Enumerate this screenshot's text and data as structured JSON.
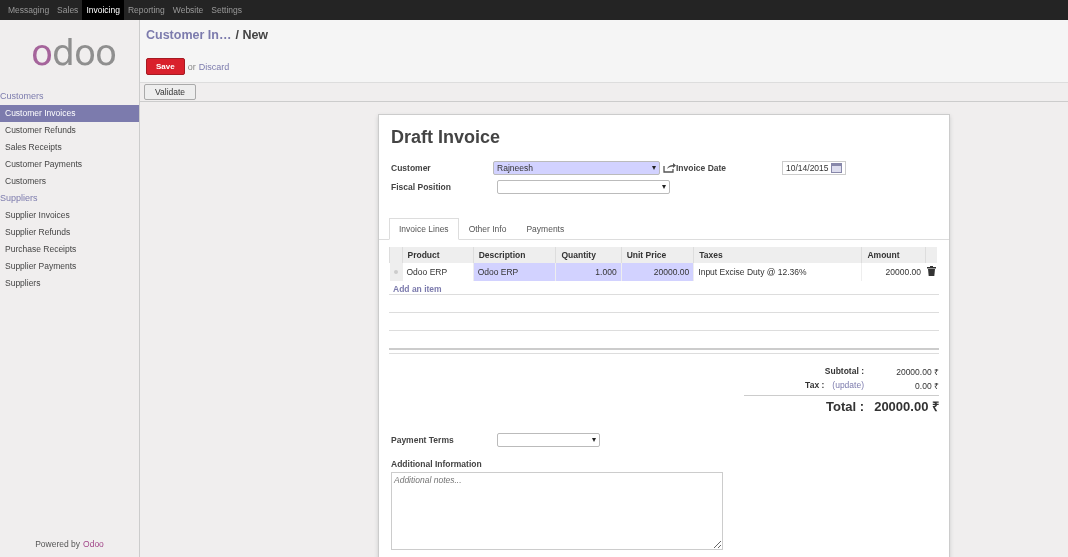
{
  "top_menu": [
    {
      "label": "Messaging",
      "selected": false
    },
    {
      "label": "Sales",
      "selected": false
    },
    {
      "label": "Invoicing",
      "selected": true
    },
    {
      "label": "Reporting",
      "selected": false
    },
    {
      "label": "Website",
      "selected": false
    },
    {
      "label": "Settings",
      "selected": false
    }
  ],
  "sidebar": {
    "logo": "odoo",
    "sections": [
      {
        "title": "Customers",
        "items": [
          {
            "label": "Customer Invoices",
            "selected": true
          },
          {
            "label": "Customer Refunds",
            "selected": false
          },
          {
            "label": "Sales Receipts",
            "selected": false
          },
          {
            "label": "Customer Payments",
            "selected": false
          },
          {
            "label": "Customers",
            "selected": false
          }
        ]
      },
      {
        "title": "Suppliers",
        "items": [
          {
            "label": "Supplier Invoices",
            "selected": false
          },
          {
            "label": "Supplier Refunds",
            "selected": false
          },
          {
            "label": "Purchase Receipts",
            "selected": false
          },
          {
            "label": "Supplier Payments",
            "selected": false
          },
          {
            "label": "Suppliers",
            "selected": false
          }
        ]
      }
    ],
    "footer": {
      "text": "Powered by",
      "link": "Odoo"
    }
  },
  "breadcrumb": {
    "parent": "Customer In…",
    "current": "/ New"
  },
  "actions": {
    "save": "Save",
    "or": "or",
    "discard": "Discard"
  },
  "toolbar": [
    "Validate"
  ],
  "sheet": {
    "title": "Draft Invoice",
    "fields_left": [
      {
        "label": "Customer",
        "value": "Rajneesh",
        "required": true,
        "external_link": true
      },
      {
        "label": "Fiscal Position",
        "required": false,
        "external_link": false
      }
    ],
    "fields_right": [
      {
        "label": "Invoice Date",
        "value": "10/14/2015"
      }
    ],
    "tabs": [
      {
        "label": "Invoice Lines",
        "selected": true
      },
      {
        "label": "Other Info",
        "selected": false
      },
      {
        "label": "Payments",
        "selected": false
      }
    ],
    "table": {
      "columns": [
        "Product",
        "Description",
        "Quantity",
        "Unit Price",
        "Taxes",
        "Amount"
      ],
      "rows": [
        {
          "cells": [
            {
              "text": "Odoo ERP",
              "required": false,
              "kind": "text"
            },
            {
              "text": "Odoo ERP",
              "required": true,
              "kind": "text"
            },
            {
              "text": "1.000",
              "required": true,
              "kind": "number"
            },
            {
              "text": "20000.00",
              "required": true,
              "kind": "number"
            },
            {
              "text": "Input Excise Duty @ 12.36%",
              "required": false,
              "kind": "text"
            },
            {
              "text": "20000.00",
              "required": false,
              "kind": "number"
            }
          ]
        }
      ],
      "add_item": "Add an item"
    },
    "totals": {
      "subtotal_label": "Subtotal :",
      "subtotal": "20000.00 ₹",
      "tax_label": "Tax :",
      "tax_update": "(update)",
      "tax": "0.00 ₹",
      "total_label": "Total :",
      "total": "20000.00 ₹"
    },
    "payment_terms": {
      "label": "Payment Terms"
    },
    "additional_info": {
      "label": "Additional Information",
      "placeholder": "Additional notes..."
    }
  }
}
